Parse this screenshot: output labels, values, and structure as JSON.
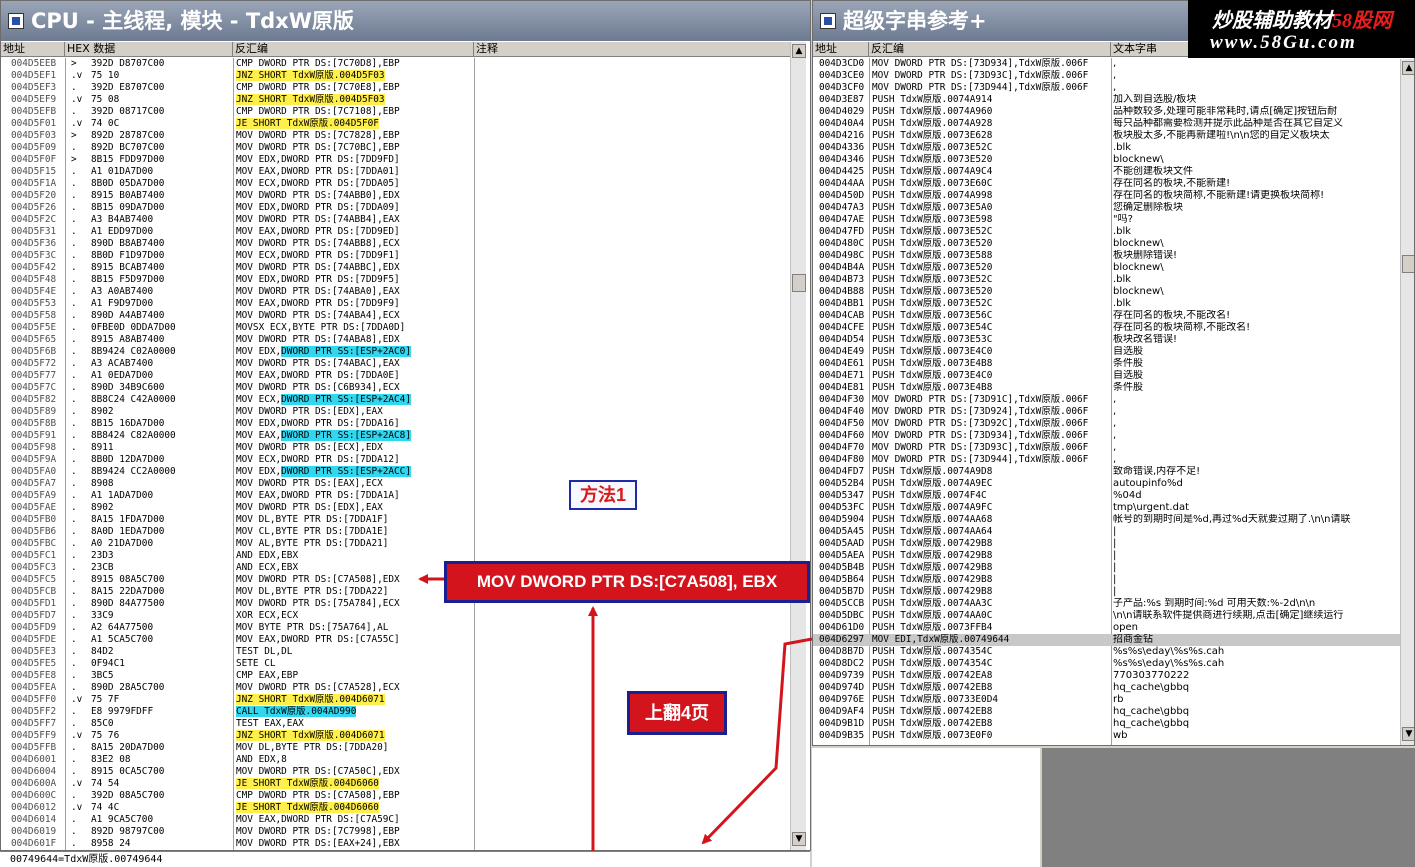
{
  "cpu_window": {
    "title": "CPU - 主线程, 模块 - TdxW原版",
    "headers": {
      "address": "地址",
      "hex": "HEX 数据",
      "disasm": "反汇编",
      "comment": "注释"
    },
    "rows": [
      {
        "a": "004D5EEB",
        "m": ">",
        "h": "392D D8707C00",
        "d": "CMP DWORD PTR DS:[7C70D8],EBP",
        "hl": ""
      },
      {
        "a": "004D5EF1",
        "m": ".v",
        "h": "75 10",
        "d": "JNZ SHORT TdxW原版.004D5F03",
        "hl": "y"
      },
      {
        "a": "004D5EF3",
        "m": ".",
        "h": "392D E8707C00",
        "d": "CMP DWORD PTR DS:[7C70E8],EBP",
        "hl": ""
      },
      {
        "a": "004D5EF9",
        "m": ".v",
        "h": "75 08",
        "d": "JNZ SHORT TdxW原版.004D5F03",
        "hl": "y"
      },
      {
        "a": "004D5EFB",
        "m": ".",
        "h": "392D 08717C00",
        "d": "CMP DWORD PTR DS:[7C7108],EBP",
        "hl": ""
      },
      {
        "a": "004D5F01",
        "m": ".v",
        "h": "74 0C",
        "d": "JE SHORT TdxW原版.004D5F0F",
        "hl": "y"
      },
      {
        "a": "004D5F03",
        "m": ">",
        "h": "892D 28787C00",
        "d": "MOV DWORD PTR DS:[7C7828],EBP",
        "hl": ""
      },
      {
        "a": "004D5F09",
        "m": ".",
        "h": "892D BC707C00",
        "d": "MOV DWORD PTR DS:[7C70BC],EBP",
        "hl": ""
      },
      {
        "a": "004D5F0F",
        "m": ">",
        "h": "8B15 FDD97D00",
        "d": "MOV EDX,DWORD PTR DS:[7DD9FD]",
        "hl": ""
      },
      {
        "a": "004D5F15",
        "m": ".",
        "h": "A1 01DA7D00",
        "d": "MOV EAX,DWORD PTR DS:[7DDA01]",
        "hl": ""
      },
      {
        "a": "004D5F1A",
        "m": ".",
        "h": "8B0D 05DA7D00",
        "d": "MOV ECX,DWORD PTR DS:[7DDA05]",
        "hl": ""
      },
      {
        "a": "004D5F20",
        "m": ".",
        "h": "8915 B0AB7400",
        "d": "MOV DWORD PTR DS:[74ABB0],EDX",
        "hl": ""
      },
      {
        "a": "004D5F26",
        "m": ".",
        "h": "8B15 09DA7D00",
        "d": "MOV EDX,DWORD PTR DS:[7DDA09]",
        "hl": ""
      },
      {
        "a": "004D5F2C",
        "m": ".",
        "h": "A3 B4AB7400",
        "d": "MOV DWORD PTR DS:[74ABB4],EAX",
        "hl": ""
      },
      {
        "a": "004D5F31",
        "m": ".",
        "h": "A1 EDD97D00",
        "d": "MOV EAX,DWORD PTR DS:[7DD9ED]",
        "hl": ""
      },
      {
        "a": "004D5F36",
        "m": ".",
        "h": "890D B8AB7400",
        "d": "MOV DWORD PTR DS:[74ABB8],ECX",
        "hl": ""
      },
      {
        "a": "004D5F3C",
        "m": ".",
        "h": "8B0D F1D97D00",
        "d": "MOV ECX,DWORD PTR DS:[7DD9F1]",
        "hl": ""
      },
      {
        "a": "004D5F42",
        "m": ".",
        "h": "8915 BCAB7400",
        "d": "MOV DWORD PTR DS:[74ABBC],EDX",
        "hl": ""
      },
      {
        "a": "004D5F48",
        "m": ".",
        "h": "8B15 F5D97D00",
        "d": "MOV EDX,DWORD PTR DS:[7DD9F5]",
        "hl": ""
      },
      {
        "a": "004D5F4E",
        "m": ".",
        "h": "A3 A0AB7400",
        "d": "MOV DWORD PTR DS:[74ABA0],EAX",
        "hl": ""
      },
      {
        "a": "004D5F53",
        "m": ".",
        "h": "A1 F9D97D00",
        "d": "MOV EAX,DWORD PTR DS:[7DD9F9]",
        "hl": ""
      },
      {
        "a": "004D5F58",
        "m": ".",
        "h": "890D A4AB7400",
        "d": "MOV DWORD PTR DS:[74ABA4],ECX",
        "hl": ""
      },
      {
        "a": "004D5F5E",
        "m": ".",
        "h": "0FBE0D 0DDA7D00",
        "d": "MOVSX ECX,BYTE PTR DS:[7DDA0D]",
        "hl": ""
      },
      {
        "a": "004D5F65",
        "m": ".",
        "h": "8915 A8AB7400",
        "d": "MOV DWORD PTR DS:[74ABA8],EDX",
        "hl": ""
      },
      {
        "a": "004D5F6B",
        "m": ".",
        "h": "8B9424 C02A0000",
        "d": "MOV EDX,",
        "d2": "DWORD PTR SS:[ESP+2AC0]",
        "hl": "c"
      },
      {
        "a": "004D5F72",
        "m": ".",
        "h": "A3 ACAB7400",
        "d": "MOV DWORD PTR DS:[74ABAC],EAX",
        "hl": ""
      },
      {
        "a": "004D5F77",
        "m": ".",
        "h": "A1 0EDA7D00",
        "d": "MOV EAX,DWORD PTR DS:[7DDA0E]",
        "hl": ""
      },
      {
        "a": "004D5F7C",
        "m": ".",
        "h": "890D 34B9C600",
        "d": "MOV DWORD PTR DS:[C6B934],ECX",
        "hl": ""
      },
      {
        "a": "004D5F82",
        "m": ".",
        "h": "8B8C24 C42A0000",
        "d": "MOV ECX,",
        "d2": "DWORD PTR SS:[ESP+2AC4]",
        "hl": "c"
      },
      {
        "a": "004D5F89",
        "m": ".",
        "h": "8902",
        "d": "MOV DWORD PTR DS:[EDX],EAX",
        "hl": ""
      },
      {
        "a": "004D5F8B",
        "m": ".",
        "h": "8B15 16DA7D00",
        "d": "MOV EDX,DWORD PTR DS:[7DDA16]",
        "hl": ""
      },
      {
        "a": "004D5F91",
        "m": ".",
        "h": "8B8424 C82A0000",
        "d": "MOV EAX,",
        "d2": "DWORD PTR SS:[ESP+2AC8]",
        "hl": "c"
      },
      {
        "a": "004D5F98",
        "m": ".",
        "h": "8911",
        "d": "MOV DWORD PTR DS:[ECX],EDX",
        "hl": ""
      },
      {
        "a": "004D5F9A",
        "m": ".",
        "h": "8B0D 12DA7D00",
        "d": "MOV ECX,DWORD PTR DS:[7DDA12]",
        "hl": ""
      },
      {
        "a": "004D5FA0",
        "m": ".",
        "h": "8B9424 CC2A0000",
        "d": "MOV EDX,",
        "d2": "DWORD PTR SS:[ESP+2ACC]",
        "hl": "c"
      },
      {
        "a": "004D5FA7",
        "m": ".",
        "h": "8908",
        "d": "MOV DWORD PTR DS:[EAX],ECX",
        "hl": ""
      },
      {
        "a": "004D5FA9",
        "m": ".",
        "h": "A1 1ADA7D00",
        "d": "MOV EAX,DWORD PTR DS:[7DDA1A]",
        "hl": ""
      },
      {
        "a": "004D5FAE",
        "m": ".",
        "h": "8902",
        "d": "MOV DWORD PTR DS:[EDX],EAX",
        "hl": ""
      },
      {
        "a": "004D5FB0",
        "m": ".",
        "h": "8A15 1FDA7D00",
        "d": "MOV DL,BYTE PTR DS:[7DDA1F]",
        "hl": ""
      },
      {
        "a": "004D5FB6",
        "m": ".",
        "h": "8A0D 1EDA7D00",
        "d": "MOV CL,BYTE PTR DS:[7DDA1E]",
        "hl": ""
      },
      {
        "a": "004D5FBC",
        "m": ".",
        "h": "A0 21DA7D00",
        "d": "MOV AL,BYTE PTR DS:[7DDA21]",
        "hl": ""
      },
      {
        "a": "004D5FC1",
        "m": ".",
        "h": "23D3",
        "d": "AND EDX,EBX",
        "hl": ""
      },
      {
        "a": "004D5FC3",
        "m": ".",
        "h": "23CB",
        "d": "AND ECX,EBX",
        "hl": ""
      },
      {
        "a": "004D5FC5",
        "m": ".",
        "h": "8915 08A5C700",
        "d": "MOV DWORD PTR DS:[C7A508],EDX",
        "hl": ""
      },
      {
        "a": "004D5FCB",
        "m": ".",
        "h": "8A15 22DA7D00",
        "d": "MOV DL,BYTE PTR DS:[7DDA22]",
        "hl": ""
      },
      {
        "a": "004D5FD1",
        "m": ".",
        "h": "890D 84A77500",
        "d": "MOV DWORD PTR DS:[75A784],ECX",
        "hl": ""
      },
      {
        "a": "004D5FD7",
        "m": ".",
        "h": "33C9",
        "d": "XOR ECX,ECX",
        "hl": ""
      },
      {
        "a": "004D5FD9",
        "m": ".",
        "h": "A2 64A77500",
        "d": "MOV BYTE PTR DS:[75A764],AL",
        "hl": ""
      },
      {
        "a": "004D5FDE",
        "m": ".",
        "h": "A1 5CA5C700",
        "d": "MOV EAX,DWORD PTR DS:[C7A55C]",
        "hl": ""
      },
      {
        "a": "004D5FE3",
        "m": ".",
        "h": "84D2",
        "d": "TEST DL,DL",
        "hl": ""
      },
      {
        "a": "004D5FE5",
        "m": ".",
        "h": "0F94C1",
        "d": "SETE CL",
        "hl": ""
      },
      {
        "a": "004D5FE8",
        "m": ".",
        "h": "3BC5",
        "d": "CMP EAX,EBP",
        "hl": ""
      },
      {
        "a": "004D5FEA",
        "m": ".",
        "h": "890D 28A5C700",
        "d": "MOV DWORD PTR DS:[C7A528],ECX",
        "hl": ""
      },
      {
        "a": "004D5FF0",
        "m": ".v",
        "h": "75 7F",
        "d": "JNZ SHORT TdxW原版.004D6071",
        "hl": "y"
      },
      {
        "a": "004D5FF2",
        "m": ".",
        "h": "E8 9979FDFF",
        "d": "CALL TdxW原版.004AD990",
        "hl": "c"
      },
      {
        "a": "004D5FF7",
        "m": ".",
        "h": "85C0",
        "d": "TEST EAX,EAX",
        "hl": ""
      },
      {
        "a": "004D5FF9",
        "m": ".v",
        "h": "75 76",
        "d": "JNZ SHORT TdxW原版.004D6071",
        "hl": "y"
      },
      {
        "a": "004D5FFB",
        "m": ".",
        "h": "8A15 20DA7D00",
        "d": "MOV DL,BYTE PTR DS:[7DDA20]",
        "hl": ""
      },
      {
        "a": "004D6001",
        "m": ".",
        "h": "83E2 08",
        "d": "AND EDX,8",
        "hl": ""
      },
      {
        "a": "004D6004",
        "m": ".",
        "h": "8915 0CA5C700",
        "d": "MOV DWORD PTR DS:[C7A50C],EDX",
        "hl": ""
      },
      {
        "a": "004D600A",
        "m": ".v",
        "h": "74 54",
        "d": "JE SHORT TdxW原版.004D6060",
        "hl": "y"
      },
      {
        "a": "004D600C",
        "m": ".",
        "h": "392D 08A5C700",
        "d": "CMP DWORD PTR DS:[C7A508],EBP",
        "hl": ""
      },
      {
        "a": "004D6012",
        "m": ".v",
        "h": "74 4C",
        "d": "JE SHORT TdxW原版.004D6060",
        "hl": "y"
      },
      {
        "a": "004D6014",
        "m": ".",
        "h": "A1 9CA5C700",
        "d": "MOV EAX,DWORD PTR DS:[C7A59C]",
        "hl": ""
      },
      {
        "a": "004D6019",
        "m": ".",
        "h": "892D 98797C00",
        "d": "MOV DWORD PTR DS:[7C7998],EBP",
        "hl": ""
      },
      {
        "a": "004D601F",
        "m": ".",
        "h": "8958 24",
        "d": "MOV DWORD PTR DS:[EAX+24],EBX",
        "hl": ""
      }
    ],
    "status": "00749644=TdxW原版.00749644"
  },
  "strings_window": {
    "title": "超级字串参考+",
    "headers": {
      "address": "地址",
      "disasm": "反汇编",
      "text": "文本字串"
    },
    "rows": [
      {
        "a": "004D3CD0",
        "d": "MOV DWORD PTR DS:[73D934],TdxW原版.006F",
        "t": ","
      },
      {
        "a": "004D3CE0",
        "d": "MOV DWORD PTR DS:[73D93C],TdxW原版.006F",
        "t": ","
      },
      {
        "a": "004D3CF0",
        "d": "MOV DWORD PTR DS:[73D944],TdxW原版.006F",
        "t": ","
      },
      {
        "a": "004D3E87",
        "d": "PUSH TdxW原版.0074A914",
        "t": "加入到自选股/板块"
      },
      {
        "a": "004D4029",
        "d": "PUSH TdxW原版.0074A960",
        "t": "品种数较多,处理可能非常耗时,请点[确定]按钮后耐"
      },
      {
        "a": "004D40A4",
        "d": "PUSH TdxW原版.0074A928",
        "t": "每只品种都需要检测并提示此品种是否在其它自定义"
      },
      {
        "a": "004D4216",
        "d": "PUSH TdxW原版.0073E628",
        "t": "板块股太多,不能再新建啦!\\n\\n您的自定义板块太"
      },
      {
        "a": "004D4336",
        "d": "PUSH TdxW原版.0073E52C",
        "t": ".blk"
      },
      {
        "a": "004D4346",
        "d": "PUSH TdxW原版.0073E520",
        "t": "blocknew\\"
      },
      {
        "a": "004D4425",
        "d": "PUSH TdxW原版.0074A9C4",
        "t": "不能创建板块文件"
      },
      {
        "a": "004D44AA",
        "d": "PUSH TdxW原版.0073E60C",
        "t": "存在同名的板块,不能新建!"
      },
      {
        "a": "004D450D",
        "d": "PUSH TdxW原版.0074A998",
        "t": "存在同名的板块简称,不能新建!请更换板块简称!"
      },
      {
        "a": "004D47A3",
        "d": "PUSH TdxW原版.0073E5A0",
        "t": "您确定删除板块"
      },
      {
        "a": "004D47AE",
        "d": "PUSH TdxW原版.0073E598",
        "t": "\"吗?"
      },
      {
        "a": "004D47FD",
        "d": "PUSH TdxW原版.0073E52C",
        "t": ".blk"
      },
      {
        "a": "004D480C",
        "d": "PUSH TdxW原版.0073E520",
        "t": "blocknew\\"
      },
      {
        "a": "004D498C",
        "d": "PUSH TdxW原版.0073E588",
        "t": "板块删除错误!"
      },
      {
        "a": "004D4B4A",
        "d": "PUSH TdxW原版.0073E520",
        "t": "blocknew\\"
      },
      {
        "a": "004D4B73",
        "d": "PUSH TdxW原版.0073E52C",
        "t": ".blk"
      },
      {
        "a": "004D4B88",
        "d": "PUSH TdxW原版.0073E520",
        "t": "blocknew\\"
      },
      {
        "a": "004D4BB1",
        "d": "PUSH TdxW原版.0073E52C",
        "t": ".blk"
      },
      {
        "a": "004D4CAB",
        "d": "PUSH TdxW原版.0073E56C",
        "t": "存在同名的板块,不能改名!"
      },
      {
        "a": "004D4CFE",
        "d": "PUSH TdxW原版.0073E54C",
        "t": "存在同名的板块简称,不能改名!"
      },
      {
        "a": "004D4D54",
        "d": "PUSH TdxW原版.0073E53C",
        "t": "板块改名错误!"
      },
      {
        "a": "004D4E49",
        "d": "PUSH TdxW原版.0073E4C0",
        "t": "自选股"
      },
      {
        "a": "004D4E61",
        "d": "PUSH TdxW原版.0073E4B8",
        "t": "条件股"
      },
      {
        "a": "004D4E71",
        "d": "PUSH TdxW原版.0073E4C0",
        "t": "自选股"
      },
      {
        "a": "004D4E81",
        "d": "PUSH TdxW原版.0073E4B8",
        "t": "条件股"
      },
      {
        "a": "004D4F30",
        "d": "MOV DWORD PTR DS:[73D91C],TdxW原版.006F",
        "t": ","
      },
      {
        "a": "004D4F40",
        "d": "MOV DWORD PTR DS:[73D924],TdxW原版.006F",
        "t": ","
      },
      {
        "a": "004D4F50",
        "d": "MOV DWORD PTR DS:[73D92C],TdxW原版.006F",
        "t": ","
      },
      {
        "a": "004D4F60",
        "d": "MOV DWORD PTR DS:[73D934],TdxW原版.006F",
        "t": ","
      },
      {
        "a": "004D4F70",
        "d": "MOV DWORD PTR DS:[73D93C],TdxW原版.006F",
        "t": ","
      },
      {
        "a": "004D4F80",
        "d": "MOV DWORD PTR DS:[73D944],TdxW原版.006F",
        "t": ","
      },
      {
        "a": "004D4FD7",
        "d": "PUSH TdxW原版.0074A9D8",
        "t": "致命错误,内存不足!"
      },
      {
        "a": "004D52B4",
        "d": "PUSH TdxW原版.0074A9EC",
        "t": "autoupinfo%d"
      },
      {
        "a": "004D5347",
        "d": "PUSH TdxW原版.0074F4C",
        "t": "%04d"
      },
      {
        "a": "004D53FC",
        "d": "PUSH TdxW原版.0074A9FC",
        "t": "tmp\\urgent.dat"
      },
      {
        "a": "004D5904",
        "d": "PUSH TdxW原版.0074AA68",
        "t": "帐号的到期时间是%d,再过%d天就要过期了.\\n\\n请联"
      },
      {
        "a": "004D5A45",
        "d": "PUSH TdxW原版.0074AA64",
        "t": "|"
      },
      {
        "a": "004D5AAD",
        "d": "PUSH TdxW原版.007429B8",
        "t": "|"
      },
      {
        "a": "004D5AEA",
        "d": "PUSH TdxW原版.007429B8",
        "t": "|"
      },
      {
        "a": "004D5B4B",
        "d": "PUSH TdxW原版.007429B8",
        "t": "|"
      },
      {
        "a": "004D5B64",
        "d": "PUSH TdxW原版.007429B8",
        "t": "|"
      },
      {
        "a": "004D5B7D",
        "d": "PUSH TdxW原版.007429B8",
        "t": "|"
      },
      {
        "a": "004D5CCB",
        "d": "PUSH TdxW原版.0074AA3C",
        "t": "子产品:%s 到期时间:%d 可用天数:%-2d\\n\\n"
      },
      {
        "a": "004D5DBC",
        "d": "PUSH TdxW原版.0074AA0C",
        "t": "\\n\\n请联系软件提供商进行续期,点击[确定]继续运行"
      },
      {
        "a": "004D61D0",
        "d": "PUSH TdxW原版.0073FFB4",
        "t": "open"
      },
      {
        "a": "004D6297",
        "d": "MOV EDI,TdxW原版.00749644",
        "t": "招商金钻",
        "sel": true
      },
      {
        "a": "004D8B7D",
        "d": "PUSH TdxW原版.0074354C",
        "t": "%s%s\\eday\\%s%s.cah"
      },
      {
        "a": "004D8DC2",
        "d": "PUSH TdxW原版.0074354C",
        "t": "%s%s\\eday\\%s%s.cah"
      },
      {
        "a": "004D9739",
        "d": "PUSH TdxW原版.00742EA8",
        "t": "770303770222"
      },
      {
        "a": "004D974D",
        "d": "PUSH TdxW原版.00742EB8",
        "t": "hq_cache\\gbbq"
      },
      {
        "a": "004D976E",
        "d": "PUSH TdxW原版.00733E0D4",
        "t": "rb"
      },
      {
        "a": "004D9AF4",
        "d": "PUSH TdxW原版.00742EB8",
        "t": "hq_cache\\gbbq"
      },
      {
        "a": "004D9B1D",
        "d": "PUSH TdxW原版.00742EB8",
        "t": "hq_cache\\gbbq"
      },
      {
        "a": "004D9B35",
        "d": "PUSH TdxW原版.0073E0F0",
        "t": "wb"
      }
    ]
  },
  "annotations": {
    "method1": "方法1",
    "mov_label": "MOV DWORD PTR DS:[C7A508], EBX",
    "page_up": "上翻4页"
  },
  "logo": {
    "line1a": "炒股辅助教材",
    "line1b": "58股网",
    "line2": "www.58Gu.com"
  },
  "colors": {
    "yellow_highlight": "#ffef4a",
    "cyan_highlight": "#31d6ef",
    "annotation_red": "#d3141d",
    "annotation_border": "#1a2090"
  }
}
